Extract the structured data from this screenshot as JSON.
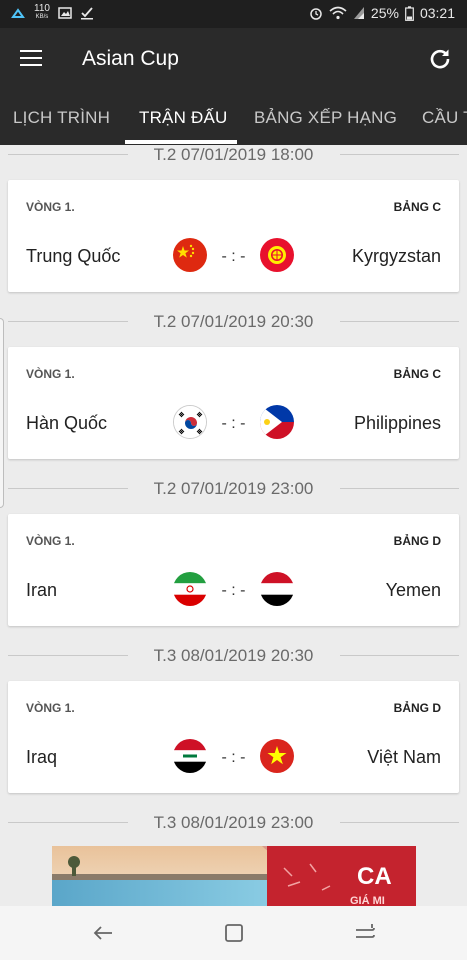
{
  "status_bar": {
    "net_speed_value": "110",
    "net_speed_unit": "KB/s",
    "battery": "25%",
    "time": "03:21"
  },
  "app": {
    "title": "Asian Cup"
  },
  "tabs": [
    {
      "label": "LỊCH TRÌNH",
      "active": false
    },
    {
      "label": "TRẬN ĐẤU",
      "active": true
    },
    {
      "label": "BẢNG XẾP HẠNG",
      "active": false
    },
    {
      "label": "CẦU T",
      "active": false
    }
  ],
  "matches": [
    {
      "date": "T.2 07/01/2019 18:00",
      "round": "VÒNG 1.",
      "group": "BẢNG C",
      "home": "Trung Quốc",
      "away": "Kyrgyzstan",
      "score": "- : -",
      "home_flag": "china-flag",
      "away_flag": "kyrgyzstan-flag"
    },
    {
      "date": "T.2 07/01/2019 20:30",
      "round": "VÒNG 1.",
      "group": "BẢNG C",
      "home": "Hàn Quốc",
      "away": "Philippines",
      "score": "- : -",
      "home_flag": "south-korea-flag",
      "away_flag": "philippines-flag"
    },
    {
      "date": "T.2 07/01/2019 23:00",
      "round": "VÒNG 1.",
      "group": "BẢNG D",
      "home": "Iran",
      "away": "Yemen",
      "score": "- : -",
      "home_flag": "iran-flag",
      "away_flag": "yemen-flag"
    },
    {
      "date": "T.3 08/01/2019 20:30",
      "round": "VÒNG 1.",
      "group": "BẢNG D",
      "home": "Iraq",
      "away": "Việt Nam",
      "score": "- : -",
      "home_flag": "iraq-flag",
      "away_flag": "vietnam-flag"
    }
  ],
  "next_date": "T.3 08/01/2019 23:00",
  "ad_banner": {
    "text_1": "CA",
    "text_2": "GIÁ MI"
  },
  "colors": {
    "app_bar": "#2a2a2a",
    "status_bar": "#1f1f1f",
    "background": "#ececec",
    "ad_red": "#c4232e"
  }
}
